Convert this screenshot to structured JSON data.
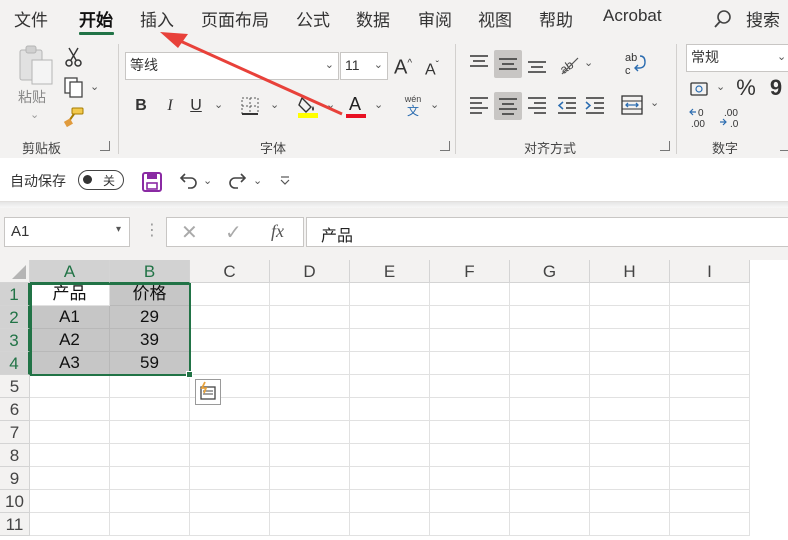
{
  "tabs": [
    "文件",
    "开始",
    "插入",
    "页面布局",
    "公式",
    "数据",
    "审阅",
    "视图",
    "帮助",
    "Acrobat"
  ],
  "active_tab": "开始",
  "search_label": "搜索",
  "ribbon": {
    "clipboard": {
      "paste_label": "粘贴",
      "group_label": "剪贴板"
    },
    "font": {
      "font_name": "等线",
      "font_size": "11",
      "group_label": "字体",
      "phonetic_top": "wén",
      "phonetic_bottom": "文",
      "bold": "B",
      "italic": "I",
      "underline": "U",
      "font_color_letter": "A",
      "grow_font": "A",
      "shrink_font": "A"
    },
    "alignment": {
      "group_label": "对齐方式"
    },
    "number": {
      "format": "常规",
      "group_label": "数字",
      "percent": "%",
      "comma": "9"
    }
  },
  "qat": {
    "autosave_label": "自动保存",
    "toggle_state": "关"
  },
  "formula_bar": {
    "name_box": "A1",
    "fx": "fx",
    "content": "产品"
  },
  "grid": {
    "columns": [
      "A",
      "B",
      "C",
      "D",
      "E",
      "F",
      "G",
      "H",
      "I"
    ],
    "rows": [
      "1",
      "2",
      "3",
      "4",
      "5",
      "6",
      "7",
      "8",
      "9",
      "10",
      "11"
    ],
    "cells": [
      [
        "产品",
        "价格"
      ],
      [
        "A1",
        "29"
      ],
      [
        "A2",
        "39"
      ],
      [
        "A3",
        "59"
      ]
    ]
  },
  "colors": {
    "excel_green": "#217346",
    "annotation_arrow": "#e8413a",
    "font_color_bar": "#e81123",
    "highlight_bar": "#ffff00",
    "save_icon": "#8a2aa3"
  }
}
